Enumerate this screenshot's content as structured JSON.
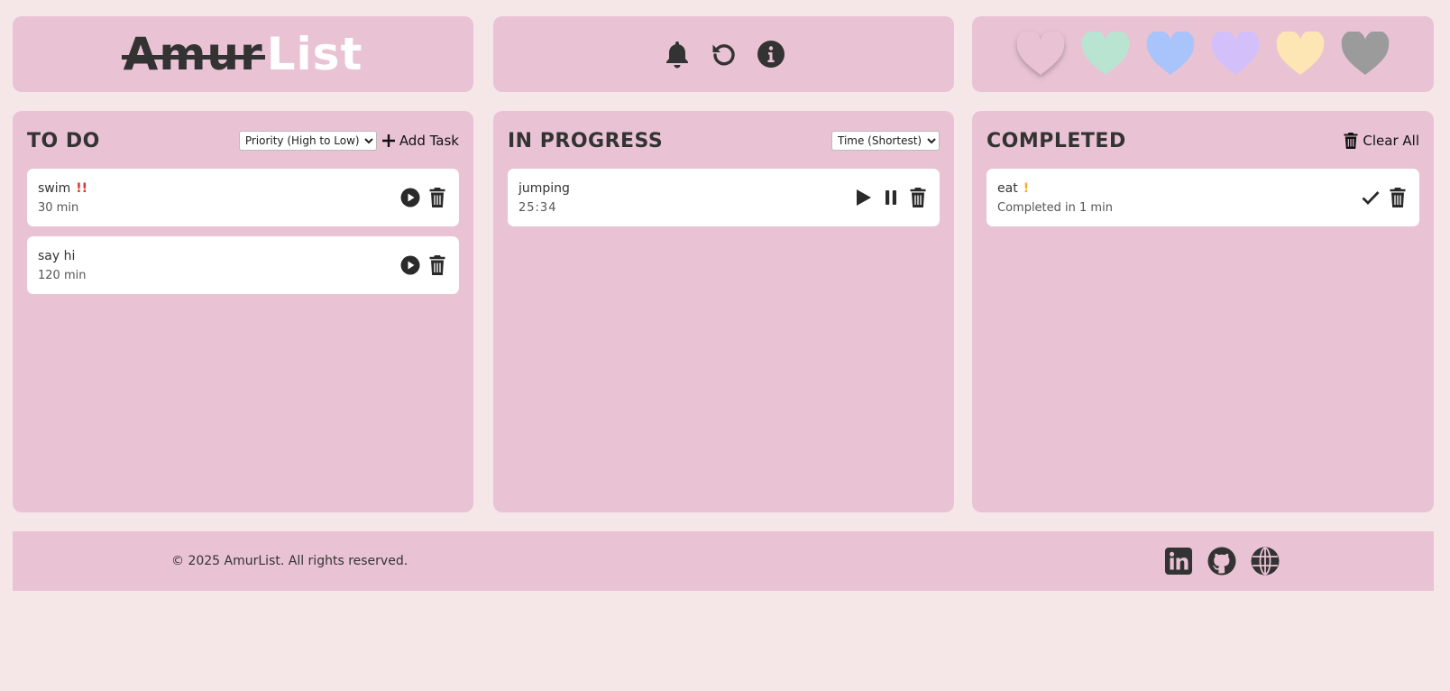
{
  "logo": {
    "strike_text": "Amur",
    "plain_text": "List"
  },
  "colors": {
    "background": "#f5e6e8",
    "panel": "#e9c3d4",
    "priority_high": "#e03030",
    "priority_medium": "#f0b020"
  },
  "header_actions": [
    {
      "icon": "bell-icon"
    },
    {
      "icon": "undo-icon"
    },
    {
      "icon": "info-icon"
    }
  ],
  "themes": [
    {
      "name": "pink",
      "color": "#e9c3d4",
      "selected": true
    },
    {
      "name": "mint",
      "color": "#b9e4d2"
    },
    {
      "name": "blue",
      "color": "#a9c4fa"
    },
    {
      "name": "lavender",
      "color": "#d3bffa"
    },
    {
      "name": "yellow",
      "color": "#fde6b3"
    },
    {
      "name": "gray",
      "color": "#9b9b9b"
    }
  ],
  "todo": {
    "title": "TO DO",
    "sort_selected": "Priority (High to Low)",
    "add_label": "Add Task",
    "tasks": [
      {
        "name": "swim",
        "priority": "!!",
        "duration": "30 min"
      },
      {
        "name": "say hi",
        "priority": "",
        "duration": "120 min"
      }
    ]
  },
  "in_progress": {
    "title": "IN PROGRESS",
    "sort_selected": "Time (Shortest)",
    "tasks": [
      {
        "name": "jumping",
        "timer": "25:34"
      }
    ]
  },
  "completed": {
    "title": "COMPLETED",
    "clear_label": "Clear All",
    "tasks": [
      {
        "name": "eat",
        "priority": "!",
        "meta": "Completed in 1 min"
      }
    ]
  },
  "footer": {
    "copyright": "© 2025 AmurList. All rights reserved.",
    "socials": [
      "linkedin-icon",
      "github-icon",
      "globe-icon"
    ]
  }
}
